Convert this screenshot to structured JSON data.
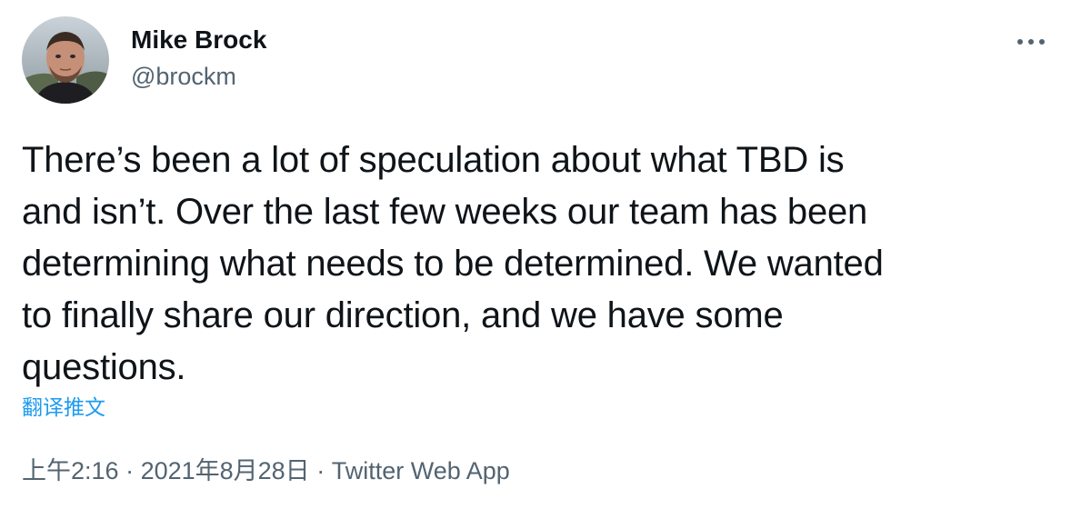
{
  "author": {
    "name": "Mike Brock",
    "handle": "@brockm"
  },
  "tweet": {
    "text": "There’s been a lot of speculation about what TBD is\nand isn’t. Over the last few weeks our team has been\ndetermining what needs to be determined. We wanted\nto finally share our direction, and we have some\nquestions.",
    "translate_label": "翻译推文"
  },
  "meta": {
    "time": "上午2:16",
    "separator": " · ",
    "date": "2021年8月28日",
    "source": "Twitter Web App"
  },
  "icons": {
    "more": "more-dots-icon",
    "avatar": "avatar-photo"
  },
  "colors": {
    "text": "#0f1419",
    "secondary": "#536471",
    "link": "#1d9bf0"
  }
}
